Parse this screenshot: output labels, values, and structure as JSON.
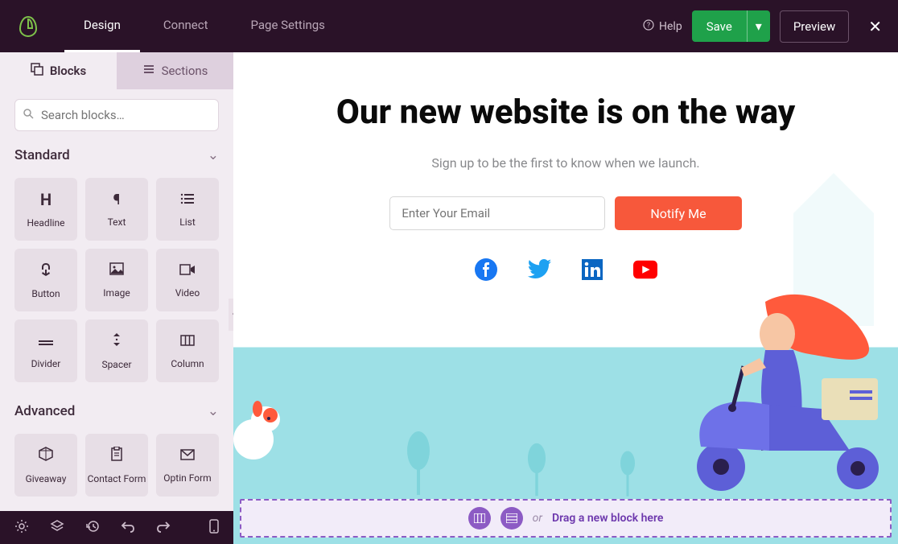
{
  "topbar": {
    "nav": {
      "design": "Design",
      "connect": "Connect",
      "page_settings": "Page Settings"
    },
    "help": "Help",
    "save": "Save",
    "preview": "Preview"
  },
  "sidebar": {
    "tabs": {
      "blocks": "Blocks",
      "sections": "Sections"
    },
    "search_placeholder": "Search blocks…",
    "groups": {
      "standard": "Standard",
      "advanced": "Advanced"
    },
    "standard_blocks": [
      {
        "label": "Headline"
      },
      {
        "label": "Text"
      },
      {
        "label": "List"
      },
      {
        "label": "Button"
      },
      {
        "label": "Image"
      },
      {
        "label": "Video"
      },
      {
        "label": "Divider"
      },
      {
        "label": "Spacer"
      },
      {
        "label": "Column"
      }
    ],
    "advanced_blocks": [
      {
        "label": "Giveaway"
      },
      {
        "label": "Contact Form"
      },
      {
        "label": "Optin Form"
      }
    ]
  },
  "canvas": {
    "headline": "Our new website is on the way",
    "subtext": "Sign up to be the first to know when we launch.",
    "email_placeholder": "Enter Your Email",
    "notify": "Notify Me",
    "socials": [
      "facebook",
      "twitter",
      "linkedin",
      "youtube"
    ],
    "dropzone": {
      "or": "or",
      "text": "Drag a new block here"
    }
  }
}
